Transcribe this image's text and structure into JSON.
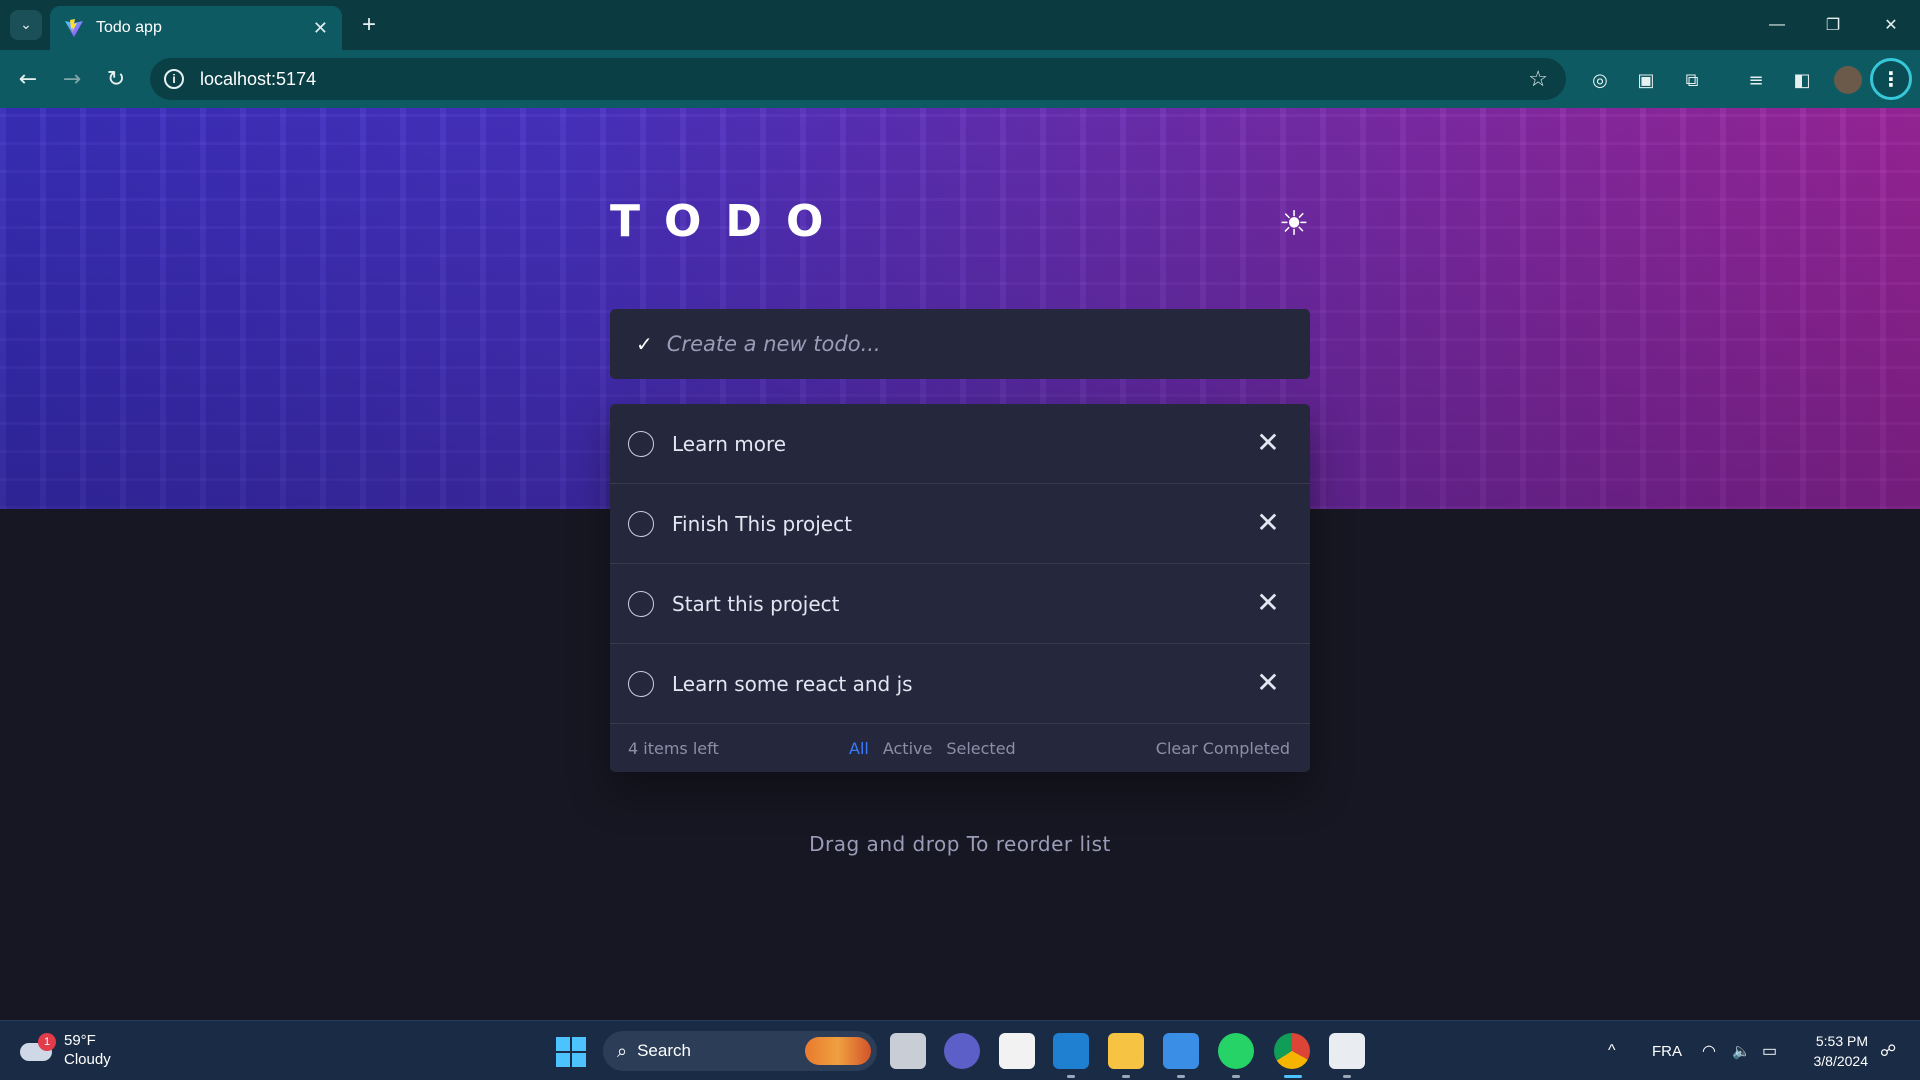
{
  "browser": {
    "tab_title": "Todo app",
    "url": "localhost:5174",
    "icons": {
      "tab_search": "chevron-down-icon",
      "favicon": "vite-logo-icon",
      "tab_close": "close-icon",
      "new_tab": "plus-icon",
      "back": "arrow-left-icon",
      "forward": "arrow-right-icon",
      "reload": "reload-icon",
      "site_info": "info-icon",
      "bookmark": "star-icon",
      "menu": "kebab-menu-icon"
    },
    "glyphs": {
      "tab_search": "⌄",
      "tab_close": "✕",
      "new_tab": "+",
      "back": "←",
      "forward": "→",
      "reload": "↻",
      "info": "i",
      "star": "☆",
      "minimize": "—",
      "maximize": "❐",
      "close": "✕",
      "menu": "⋮",
      "ext1": "◎",
      "ext2": "▣",
      "ext3": "⧉",
      "ext4": "≡",
      "ext5": "◧"
    }
  },
  "app": {
    "title": "TODO",
    "theme_icon": "☀",
    "new_todo": {
      "check_icon": "✓",
      "placeholder": "Create a new todo..."
    },
    "todos": [
      {
        "text": "Learn more",
        "completed": false
      },
      {
        "text": "Finish This project",
        "completed": false
      },
      {
        "text": "Start this project",
        "completed": false
      },
      {
        "text": "Learn some react and js",
        "completed": false
      }
    ],
    "delete_icon": "✕",
    "footer": {
      "items_left": "4 items left",
      "filters": [
        "All",
        "Active",
        "Selected"
      ],
      "active_filter": "All",
      "clear_completed": "Clear Completed"
    },
    "hint": "Drag and drop To reorder list",
    "colors": {
      "accent": "#3a7bfd",
      "card": "#25273d",
      "background": "#171723"
    }
  },
  "taskbar": {
    "weather": {
      "badge": "1",
      "temperature": "59°F",
      "condition": "Cloudy"
    },
    "search_label": "Search",
    "search_icon": "⌕",
    "language": "FRA",
    "tray_chevron": "^",
    "tray_icons": {
      "wifi": "◠",
      "volume": "🔈",
      "battery": "▭",
      "notifications": "☍"
    },
    "time": "5:53 PM",
    "date": "3/8/2024"
  }
}
